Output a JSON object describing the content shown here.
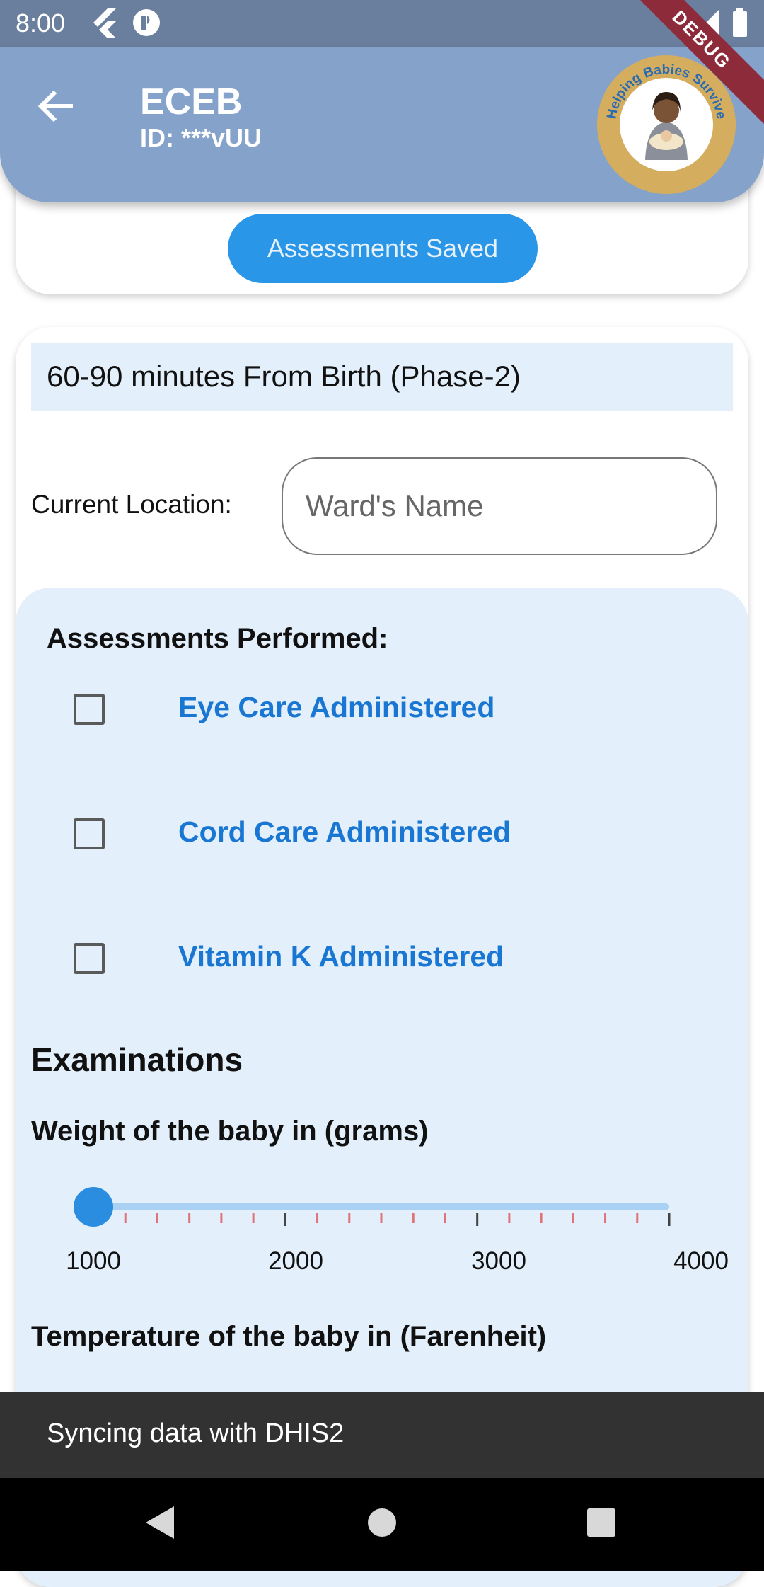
{
  "status_bar": {
    "time": "8:00",
    "icons": [
      "flutter-icon",
      "notification-app-icon",
      "wifi-icon",
      "signal-icon",
      "battery-icon"
    ],
    "debug_banner": "DEBUG"
  },
  "app_bar": {
    "title": "ECEB",
    "subtitle": "ID: ***vUU",
    "back_icon": "arrow-back-icon",
    "logo_text": "Helping Babies Survive",
    "background": "#85a2cb"
  },
  "save_card": {
    "button_label": "Assessments Saved",
    "button_color": "#2a96e8"
  },
  "phase": {
    "header": "60-90 minutes From Birth (Phase-2)"
  },
  "location": {
    "label": "Current Location:",
    "placeholder": "Ward's Name",
    "value": ""
  },
  "assessments": {
    "title": "Assessments Performed:",
    "items": [
      {
        "label": "Eye Care Administered",
        "checked": false
      },
      {
        "label": "Cord Care Administered",
        "checked": false
      },
      {
        "label": "Vitamin K Administered",
        "checked": false
      }
    ],
    "label_color": "#1976d2"
  },
  "examinations": {
    "title": "Examinations",
    "weight": {
      "label": "Weight of the baby in (grams)",
      "min": 1000,
      "max": 4000,
      "value": 1000,
      "tick_labels": [
        "1000",
        "2000",
        "3000",
        "4000"
      ],
      "minor_ticks": 18
    },
    "temperature": {
      "label": "Temperature of the baby in (Farenheit)"
    }
  },
  "snackbar": {
    "text": "Syncing data with DHIS2"
  },
  "nav_bar": {
    "buttons": [
      "back-triangle-icon",
      "home-circle-icon",
      "recents-square-icon"
    ]
  }
}
